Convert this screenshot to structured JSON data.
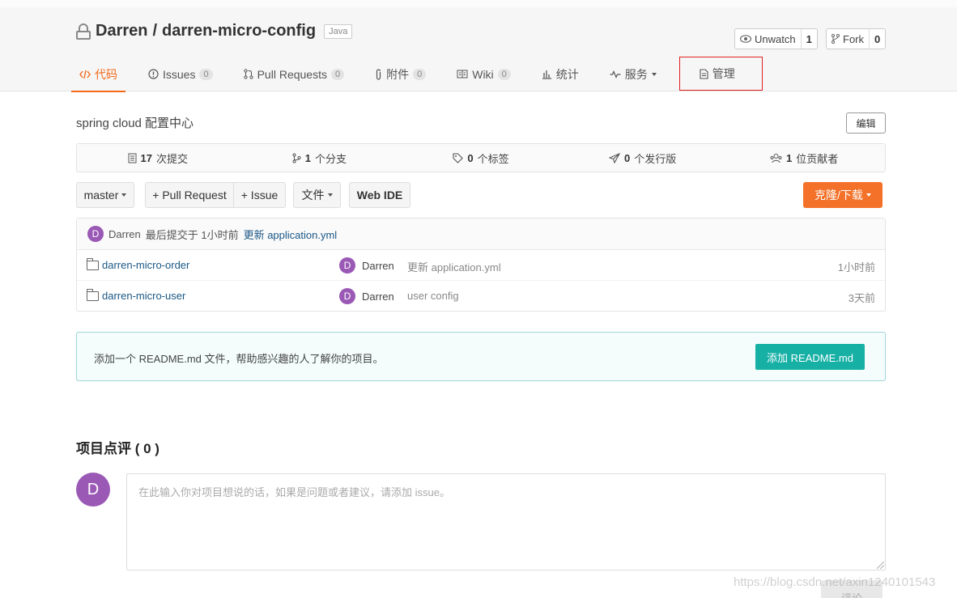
{
  "repo": {
    "owner": "Darren",
    "separator": "/",
    "name": "darren-micro-config",
    "language": "Java"
  },
  "watch": {
    "label": "Unwatch",
    "count": "1"
  },
  "fork": {
    "label": "Fork",
    "count": "0"
  },
  "tabs": [
    {
      "label": "代码",
      "badge": null
    },
    {
      "label": "Issues",
      "badge": "0"
    },
    {
      "label": "Pull Requests",
      "badge": "0"
    },
    {
      "label": "附件",
      "badge": "0"
    },
    {
      "label": "Wiki",
      "badge": "0"
    },
    {
      "label": "统计",
      "badge": null
    },
    {
      "label": "服务",
      "badge": null
    },
    {
      "label": "管理",
      "badge": null
    }
  ],
  "description": "spring cloud 配置中心",
  "edit_label": "编辑",
  "stats": [
    {
      "value": "17",
      "label": "次提交"
    },
    {
      "value": "1",
      "label": "个分支"
    },
    {
      "value": "0",
      "label": "个标签"
    },
    {
      "value": "0",
      "label": "个发行版"
    },
    {
      "value": "1",
      "label": "位贡献者"
    }
  ],
  "toolbar": {
    "branch": "master",
    "pull_request": "+ Pull Request",
    "issue": "+ Issue",
    "file": "文件",
    "webide": "Web IDE",
    "clone": "克隆/下载"
  },
  "last_commit": {
    "avatar": "D",
    "author": "Darren",
    "text": "最后提交于 1小时前",
    "message": "更新 application.yml"
  },
  "files": [
    {
      "name": "darren-micro-order",
      "avatar": "D",
      "author": "Darren",
      "message": "更新 application.yml",
      "time": "1小时前"
    },
    {
      "name": "darren-micro-user",
      "avatar": "D",
      "author": "Darren",
      "message": "user config",
      "time": "3天前"
    }
  ],
  "readme": {
    "text": "添加一个 README.md 文件，帮助感兴趣的人了解你的项目。",
    "button": "添加 README.md"
  },
  "review": {
    "title": "项目点评 ( 0 )",
    "avatar": "D",
    "placeholder": "在此输入你对项目想说的话，如果是问题或者建议，请添加 issue。",
    "submit": "评论"
  },
  "watermark": "https://blog.csdn.net/axin1240101543"
}
